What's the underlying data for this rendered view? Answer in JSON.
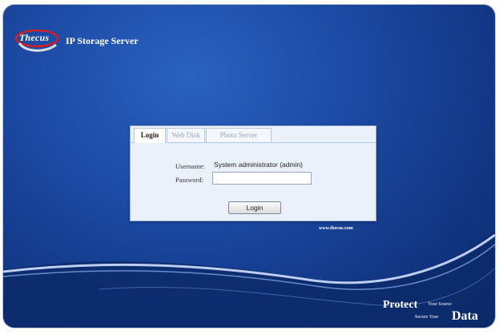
{
  "brand": {
    "logo_text": "Thecus",
    "product_name": "IP Storage Server"
  },
  "tabs": [
    {
      "label": "Login",
      "active": true
    },
    {
      "label": "Web Disk",
      "active": false
    },
    {
      "label": "Photo Server",
      "active": false
    }
  ],
  "form": {
    "username_label": "Username:",
    "username_value": "System administrator (admin)",
    "password_label": "Password:",
    "password_value": "",
    "login_button_label": "Login"
  },
  "footer": {
    "site_url": "www.thecus.com",
    "slogan_protect": "Protect",
    "slogan_your_source": "Your Source",
    "slogan_secure_your": "Secure Your",
    "slogan_data": "Data"
  },
  "colors": {
    "background_blue": "#1c4aa4",
    "panel_background": "#eaf1fb",
    "logo_red": "#d21f1f"
  }
}
